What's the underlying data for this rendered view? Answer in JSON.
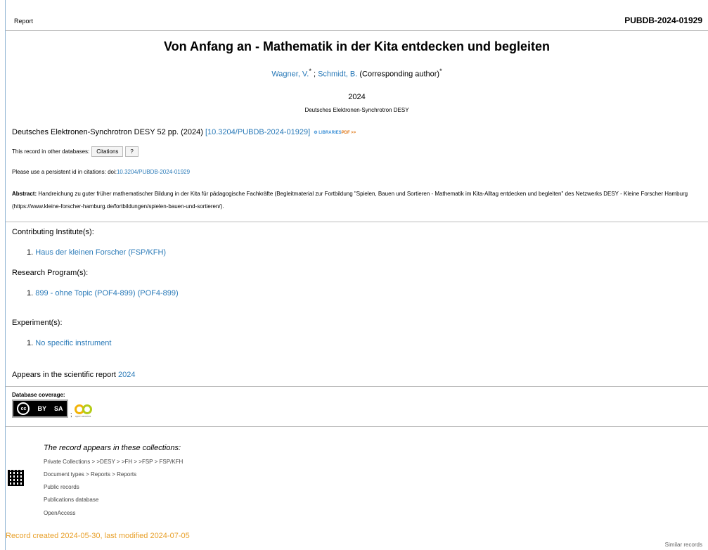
{
  "header": {
    "type_label": "Report",
    "record_id": "PUBDB-2024-01929"
  },
  "record": {
    "title": "Von Anfang an - Mathematik in der Kita entdecken und begleiten",
    "author1": "Wagner, V.",
    "author1_mark": "*",
    "author_sep": " ; ",
    "author2": "Schmidt, B.",
    "author2_role": " (Corresponding author)",
    "author2_mark": "*",
    "year": "2024",
    "publisher": "Deutsches Elektronen-Synchrotron DESY",
    "citation_text": "Deutsches Elektronen-Synchrotron DESY 52 pp. (2024)",
    "doi_link": "[10.3204/PUBDB-2024-01929]",
    "libraries_badge": "LIBRARIES",
    "libraries_badge_suffix": "PDF >>",
    "other_db_label": "This record in other databases:",
    "citations_button": "Citations",
    "help_button": "?",
    "persistent_label": "Please use a persistent id in citations: doi:",
    "persistent_doi": "10.3204/PUBDB-2024-01929",
    "abstract_label": "Abstract:",
    "abstract_text": " Handreichung zu guter früher mathematischer Bildung in der Kita für pädagogische Fachkräfte (Begleitmaterial zur Fortbildung \"Spielen, Bauen und Sortieren - Mathematik im Kita-Alltag entdecken und begleiten\" des Netzwerks DESY - Kleine Forscher Hamburg (https://www.kleine-forscher-hamburg.de/fortbildungen/spielen-bauen-und-sortieren/)."
  },
  "sections": {
    "institutes_label": "Contributing Institute(s):",
    "institute_1": "Haus der kleinen Forscher (FSP/KFH)",
    "programs_label": "Research Program(s):",
    "program_1": "899 - ohne Topic (POF4-899) (POF4-899)",
    "experiments_label": "Experiment(s):",
    "experiment_1": "No specific instrument",
    "report_label": "Appears in the scientific report ",
    "report_year": "2024",
    "item_num": "1."
  },
  "coverage": {
    "label": "Database coverage:",
    "cc_by": "BY",
    "cc_sa": "SA",
    "oa_caption": "open access",
    "separator": ";"
  },
  "collections": {
    "title": "The record appears in these collections:",
    "private": [
      "Private Collections",
      ">DESY",
      ">FH",
      ">FSP",
      "FSP/KFH"
    ],
    "doctypes": [
      "Document types",
      "Reports",
      "Reports"
    ],
    "public": "Public records",
    "publications": "Publications database",
    "openaccess": "OpenAccess",
    "sep": " > "
  },
  "footer": {
    "created": "Record created 2024-05-30, last modified 2024-07-05",
    "similar": "Similar records"
  }
}
